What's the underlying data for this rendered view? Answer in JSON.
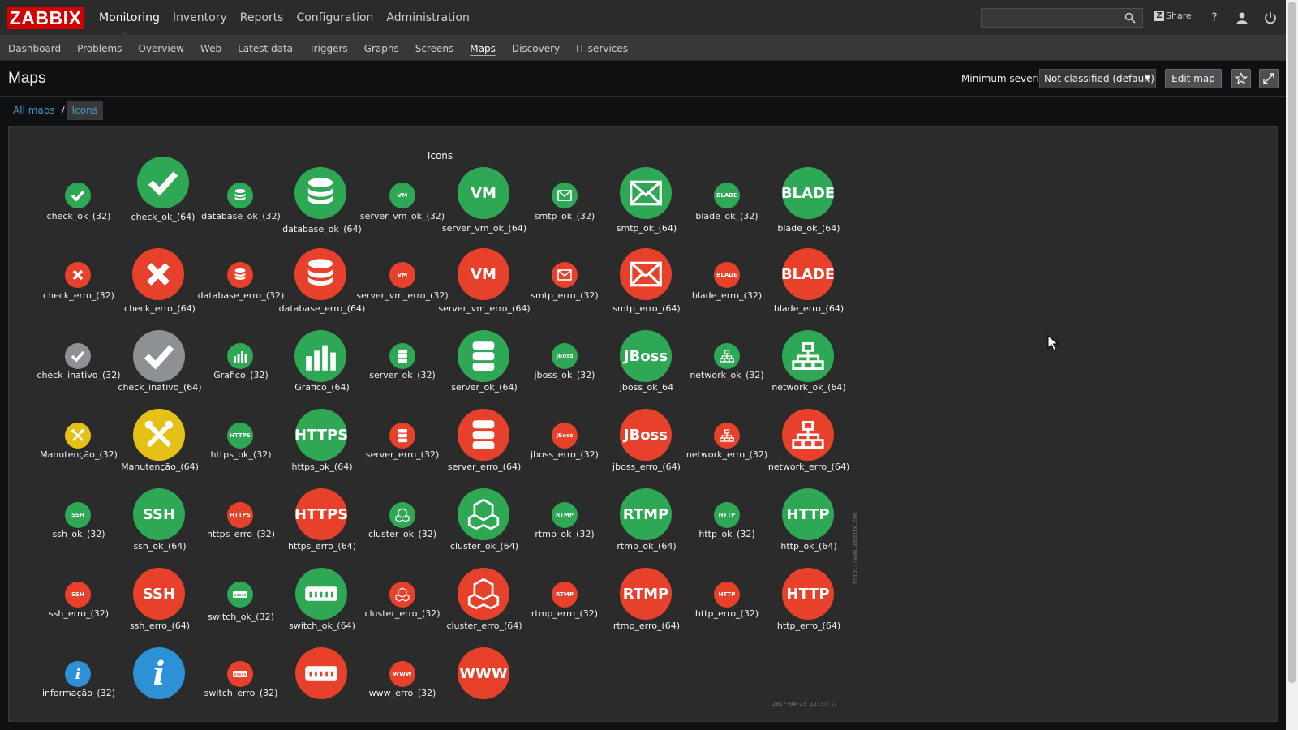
{
  "app": {
    "logo": "ZABBIX"
  },
  "mainmenu": {
    "items": [
      {
        "label": "Monitoring",
        "selected": true
      },
      {
        "label": "Inventory"
      },
      {
        "label": "Reports"
      },
      {
        "label": "Configuration"
      },
      {
        "label": "Administration"
      }
    ]
  },
  "topright": {
    "share_label": "Share",
    "help": "?",
    "search_placeholder": ""
  },
  "submenu": {
    "items": [
      {
        "label": "Dashboard"
      },
      {
        "label": "Problems"
      },
      {
        "label": "Overview"
      },
      {
        "label": "Web"
      },
      {
        "label": "Latest data"
      },
      {
        "label": "Triggers"
      },
      {
        "label": "Graphs"
      },
      {
        "label": "Screens"
      },
      {
        "label": "Maps",
        "selected": true
      },
      {
        "label": "Discovery"
      },
      {
        "label": "IT services"
      }
    ]
  },
  "header": {
    "title": "Maps",
    "severity_label": "Minimum severity",
    "severity_value": "Not classified (default)",
    "edit_map_label": "Edit map"
  },
  "breadcrumb": {
    "root": "All maps",
    "separator": "/",
    "current": "Icons"
  },
  "map": {
    "title": "Icons",
    "url": "http://www.zabbix.com",
    "timestamp": "2017-04-23 12:37:17",
    "labels": {
      "r1": [
        "check_ok_(32)",
        "check_ok_(64)",
        "database_ok_(32)",
        "database_ok_(64)",
        "server_vm_ok_(32)",
        "server_vm_ok_(64)",
        "smtp_ok_(32)",
        "smtp_ok_(64)",
        "blade_ok_(32)",
        "blade_ok_(64)"
      ],
      "r2": [
        "check_erro_(32)",
        "check_erro_(64)",
        "database_erro_(32)",
        "database_erro_(64)",
        "server_vm_erro_(32)",
        "server_vm_erro_(64)",
        "smtp_erro_(32)",
        "smtp_erro_(64)",
        "blade_erro_(32)",
        "blade_erro_(64)"
      ],
      "r3": [
        "check_inativo_(32)",
        "check_inativo_(64)",
        "Grafico_(32)",
        "Grafico_(64)",
        "server_ok_(32)",
        "server_ok_(64)",
        "jboss_ok_(32)",
        "jboss_ok_64",
        "network_ok_(32)",
        "network_ok_(64)"
      ],
      "r4": [
        "Manutenção_(32)",
        "Manutenção_(64)",
        "https_ok_(32)",
        "https_ok_(64)",
        "server_erro_(32)",
        "server_erro_(64)",
        "jboss_erro_(32)",
        "jboss_erro_(64)",
        "network_erro_(32)",
        "network_erro_(64)"
      ],
      "r5": [
        "ssh_ok_(32)",
        "ssh_ok_(64)",
        "https_erro_(32)",
        "https_erro_(64)",
        "cluster_ok_(32)",
        "cluster_ok_(64)",
        "rtmp_ok_(32)",
        "rtmp_ok_(64)",
        "http_ok_(32)",
        "http_ok_(64)"
      ],
      "r6": [
        "ssh_erro_(32)",
        "ssh_erro_(64)",
        "switch_ok_(32)",
        "switch_ok_(64)",
        "cluster_erro_(32)",
        "cluster_erro_(64)",
        "rtmp_erro_(32)",
        "rtmp_erro_(64)",
        "http_erro_(32)",
        "http_erro_(64)"
      ],
      "r7": [
        "informação_(32)",
        "",
        "switch_erro_(32)",
        "",
        "www_erro_(32)",
        ""
      ]
    },
    "glyphs": {
      "blade": "BLADE",
      "jboss": "JBoss",
      "https": "HTTPS",
      "ssh": "SSH",
      "rtmp": "RTMP",
      "http": "HTTP",
      "www": "WWW",
      "info": "i",
      "vm": "VM"
    }
  },
  "colors": {
    "ok": "#2ea855",
    "error": "#e8412b",
    "inactive": "#8e9193",
    "maintenance": "#e5c116",
    "info": "#2c91d6",
    "brand": "#d40000"
  }
}
